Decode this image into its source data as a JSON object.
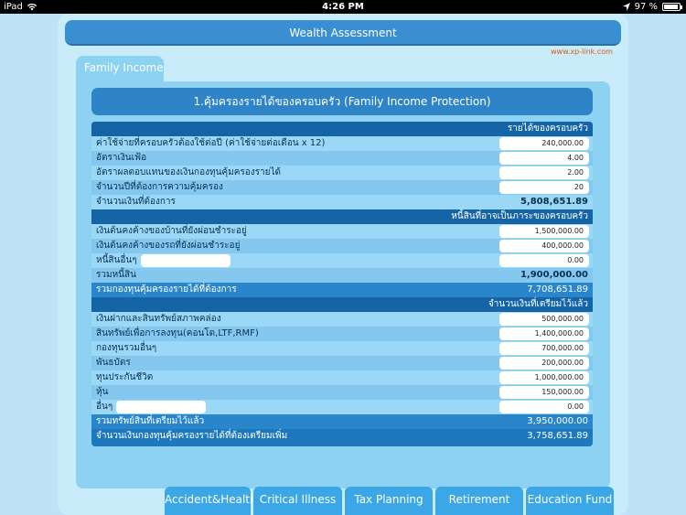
{
  "status_bar": {
    "device": "iPad",
    "time": "4:26 PM",
    "battery": "97 %",
    "battery_level": 0.97
  },
  "header": {
    "title": "Wealth Assessment",
    "site": "www.xp-link.com"
  },
  "tab": {
    "label": "Family Income"
  },
  "card": {
    "title": "1.คุ้มครองรายได้ของครอบครัว (Family Income Protection)"
  },
  "sections": {
    "income": {
      "title": "รายได้ของครอบครัว"
    },
    "debt": {
      "title": "หนี้สินที่อาจเป็นภาระของครอบครัว"
    },
    "prepared": {
      "title": "จำนวนเงินที่เตรียมไว้แล้ว"
    }
  },
  "rows": {
    "annual_expense": {
      "label": "ค่าใช้จ่ายที่ครอบครัวต้องใช้ต่อปี (ค่าใช้จ่ายต่อเดือน x 12)",
      "value": "240,000.00"
    },
    "inflation": {
      "label": "อัตราเงินเฟ้อ",
      "value": "4.00"
    },
    "return_rate": {
      "label": "อัตราผลตอบแทนของเงินกองทุนคุ้มครองรายได้",
      "value": "2.00"
    },
    "years": {
      "label": "จำนวนปีที่ต้องการความคุ้มครอง",
      "value": "20"
    },
    "needed": {
      "label": "จำนวนเงินที่ต้องการ",
      "value": "5,808,651.89"
    },
    "house_loan": {
      "label": "เงินต้นคงค้างของบ้านที่ยังผ่อนชำระอยู่",
      "value": "1,500,000.00"
    },
    "car_loan": {
      "label": "เงินต้นคงค้างของรถที่ยังผ่อนชำระอยู่",
      "value": "400,000.00"
    },
    "other_debt": {
      "label": "หนี้สินอื่นๆ",
      "value": "0.00"
    },
    "total_debt": {
      "label": "รวมหนี้สิน",
      "value": "1,900,000.00"
    },
    "total_fund_needed": {
      "label": "รวมกองทุนคุ้มครองรายได้ที่ต้องการ",
      "value": "7,708,651.89"
    },
    "deposits": {
      "label": "เงินฝากและสินทรัพย์สภาพคล่อง",
      "value": "500,000.00"
    },
    "investments": {
      "label": "สินทรัพย์เพื่อการลงทุน(คอนโด,LTF,RMF)",
      "value": "1,400,000.00"
    },
    "other_funds": {
      "label": "กองทุนรวมอื่นๆ",
      "value": "700,000.00"
    },
    "bonds": {
      "label": "พันธบัตร",
      "value": "200,000.00"
    },
    "life_insurance": {
      "label": "ทุนประกันชีวิต",
      "value": "1,000,000.00"
    },
    "stocks": {
      "label": "หุ้น",
      "value": "150,000.00"
    },
    "others": {
      "label": "อื่นๆ",
      "value": "0.00"
    },
    "total_assets": {
      "label": "รวมทรัพย์สินที่เตรียมไว้แล้ว",
      "value": "3,950,000.00"
    },
    "additional_needed": {
      "label": "จำนวนเงินกองทุนคุ้มครองรายได้ที่ต้องเตรียมเพิ่ม",
      "value": "3,758,651.89"
    }
  },
  "bottom_tabs": [
    "Accident&Health",
    "Critical Illness",
    "Tax Planning",
    "Retirement Fund",
    "Education Fund"
  ]
}
